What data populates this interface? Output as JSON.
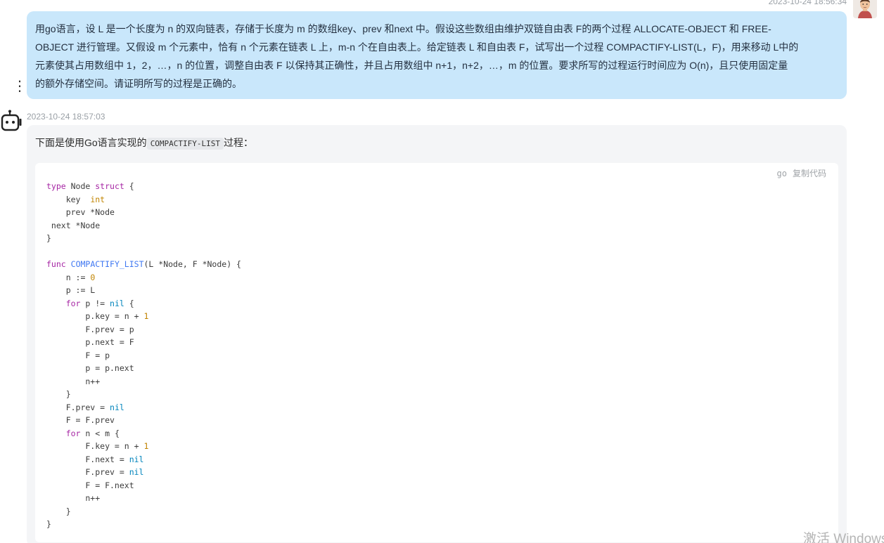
{
  "user_message": {
    "timestamp": "2023-10-24 18:56:34",
    "lines": [
      "用go语言，设 L 是一个长度为 n 的双向链表，存储于长度为 m 的数组key、prev 和next 中。假设这些数组由维护双链自由表 F的两个过程 ALLOCATE-OBJECT 和 FREE-",
      "OBJECT 进行管理。又假设 m 个元素中，恰有 n 个元素在链表 L 上，m-n 个在自由表上。给定链表 L 和自由表 F，试写出一个过程 COMPACTIFY-LIST(L，F)，用来移动 L中的",
      "元素使其占用数组中 1，2，…，n 的位置，调整自由表 F 以保持其正确性，并且占用数组中 n+1，n+2，…，m 的位置。要求所写的过程运行时间应为 O(n)，且只使用固定量",
      "的额外存储空间。请证明所写的过程是正确的。"
    ]
  },
  "bot_message": {
    "timestamp": "2023-10-24 18:57:03",
    "intro_before": "下面是使用Go语言实现的",
    "intro_code": "COMPACTIFY-LIST",
    "intro_after": "过程：",
    "code_lang": "go",
    "copy_label": "复制代码",
    "code": [
      "type Node struct {",
      "    key  int",
      "    prev *Node",
      " next *Node",
      "}",
      "",
      "func COMPACTIFY_LIST(L *Node, F *Node) {",
      "    n := 0",
      "    p := L",
      "    for p != nil {",
      "        p.key = n + 1",
      "        F.prev = p",
      "        p.next = F",
      "        F = p",
      "        p = p.next",
      "        n++",
      "    }",
      "    F.prev = nil",
      "    F = F.prev",
      "    for n < m {",
      "        F.key = n + 1",
      "        F.next = nil",
      "        F.prev = nil",
      "        F = F.next",
      "        n++",
      "    }",
      "}"
    ]
  },
  "watermark": "激活 Windows",
  "icons": {
    "more": "more-vertical-icon",
    "user_avatar": "user-avatar-icon",
    "bot_avatar": "robot-icon"
  },
  "colors": {
    "user_bubble": "#c9e7fb",
    "bot_bubble": "#f4f5f7",
    "keyword": "#a626a4",
    "function": "#4078f2",
    "number": "#c18401",
    "literal": "#0184bc"
  }
}
